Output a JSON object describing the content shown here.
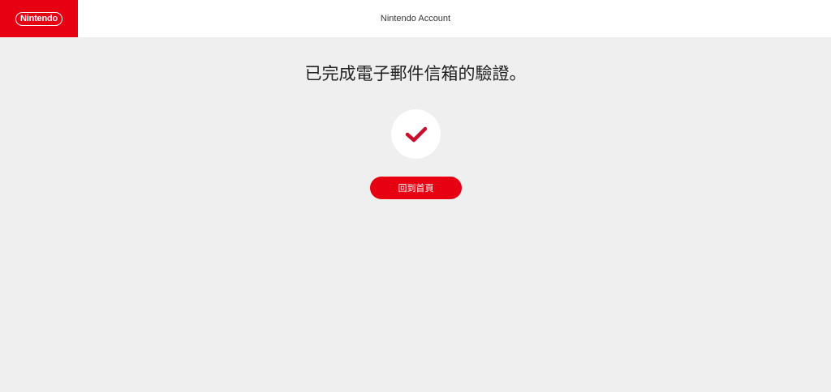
{
  "header": {
    "logo_text": "Nintendo",
    "title": "Nintendo Account"
  },
  "main": {
    "message": "已完成電子郵件信箱的驗證。",
    "check_icon": "checkmark-icon",
    "home_button_label": "回到首頁"
  },
  "colors": {
    "brand_red": "#e60012",
    "background": "#efefef",
    "header_bg": "#ffffff"
  }
}
